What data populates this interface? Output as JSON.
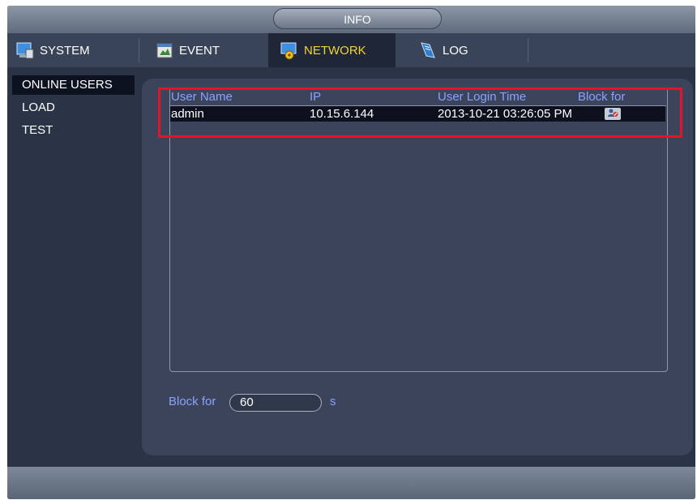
{
  "window": {
    "title": "INFO"
  },
  "tabs": [
    {
      "label": "SYSTEM",
      "icon": "monitor-icon",
      "active": false
    },
    {
      "label": "EVENT",
      "icon": "event-icon",
      "active": false
    },
    {
      "label": "NETWORK",
      "icon": "network-icon",
      "active": true
    },
    {
      "label": "LOG",
      "icon": "log-book-icon",
      "active": false
    }
  ],
  "sidebar": {
    "items": [
      {
        "label": "ONLINE USERS",
        "active": true
      },
      {
        "label": "LOAD",
        "active": false
      },
      {
        "label": "TEST",
        "active": false
      }
    ]
  },
  "table": {
    "headers": [
      "User Name",
      "IP",
      "User Login Time",
      "Block for"
    ],
    "rows": [
      {
        "user": "admin",
        "ip": "10.15.6.144",
        "login_time": "2013-10-21 03:26:05 PM",
        "block_icon": "block-user-icon"
      }
    ]
  },
  "block": {
    "label": "Block for",
    "value": "60",
    "unit": "s"
  },
  "colors": {
    "accent_header_text": "#8aa2ff",
    "active_tab_text": "#f2d437",
    "highlight_box": "#e8112b"
  }
}
